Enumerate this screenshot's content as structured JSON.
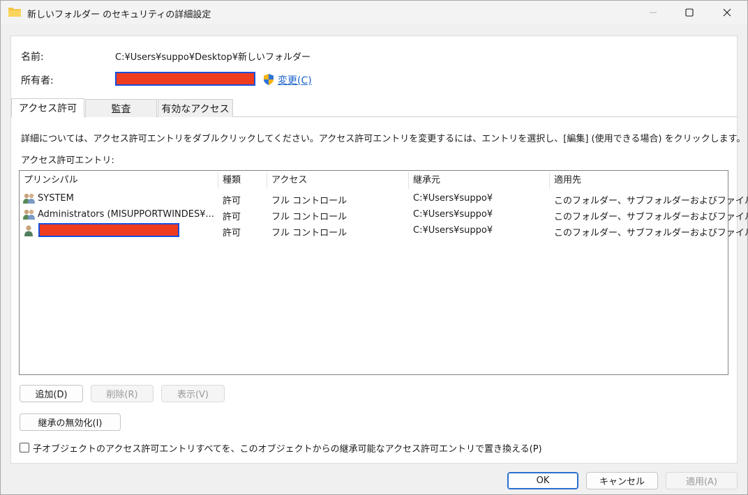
{
  "window": {
    "title": "新しいフォルダー のセキュリティの詳細設定"
  },
  "header": {
    "name_label": "名前:",
    "name_value": "C:¥Users¥suppo¥Desktop¥新しいフォルダー",
    "owner_label": "所有者:",
    "change_link": "変更(C)"
  },
  "tabs": [
    {
      "label": "アクセス許可",
      "active": true
    },
    {
      "label": "監査",
      "active": false
    },
    {
      "label": "有効なアクセス",
      "active": false
    }
  ],
  "instructions": "詳細については、アクセス許可エントリをダブルクリックしてください。アクセス許可エントリを変更するには、エントリを選択し、[編集] (使用できる場合) をクリックします。",
  "entries_label": "アクセス許可エントリ:",
  "table": {
    "columns": [
      "プリンシパル",
      "種類",
      "アクセス",
      "継承元",
      "適用先"
    ],
    "rows": [
      {
        "principal": "SYSTEM",
        "type": "許可",
        "access": "フル コントロール",
        "inherited_from": "C:¥Users¥suppo¥",
        "applies_to": "このフォルダー、サブフォルダーおよびファイル",
        "icon": "group-icon"
      },
      {
        "principal": "Administrators (MISUPPORTWINDES¥...",
        "type": "許可",
        "access": "フル コントロール",
        "inherited_from": "C:¥Users¥suppo¥",
        "applies_to": "このフォルダー、サブフォルダーおよびファイル",
        "icon": "group-icon"
      },
      {
        "principal": "",
        "type": "許可",
        "access": "フル コントロール",
        "inherited_from": "C:¥Users¥suppo¥",
        "applies_to": "このフォルダー、サブフォルダーおよびファイル",
        "icon": "user-icon"
      }
    ]
  },
  "buttons": {
    "add": "追加(D)",
    "remove": "削除(R)",
    "view": "表示(V)",
    "disable_inheritance": "継承の無効化(I)",
    "ok": "OK",
    "cancel": "キャンセル",
    "apply": "適用(A)"
  },
  "replace_checkbox_label": "子オブジェクトのアクセス許可エントリすべてを、このオブジェクトからの継承可能なアクセス許可エントリで置き換える(P)",
  "colors": {
    "redaction_fill": "#f03c1e",
    "redaction_border": "#1550e0",
    "link": "#1a63c8"
  }
}
